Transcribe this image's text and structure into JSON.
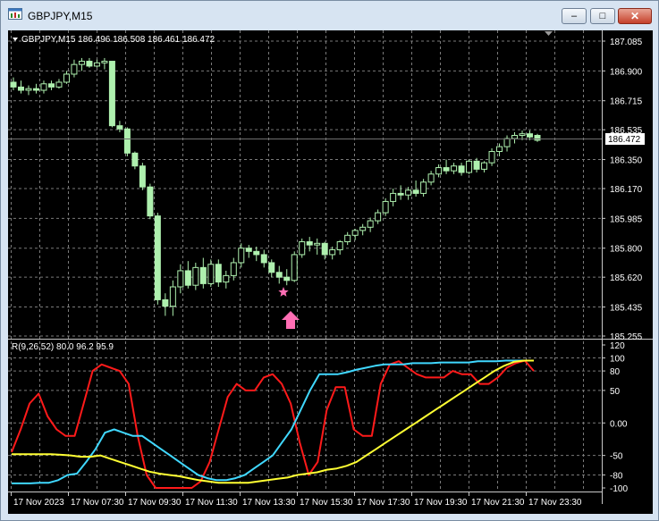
{
  "window": {
    "title": "GBPJPY,M15",
    "buttons": {
      "minimize": "–",
      "maximize": "□",
      "close": "✕"
    }
  },
  "main_chart": {
    "header": "GBPJPY,M15  186.496 186.508 186.461 186.472",
    "current_price": "186.472",
    "y_ticks": [
      "187.085",
      "186.900",
      "186.715",
      "186.535",
      "186.350",
      "186.170",
      "185.985",
      "185.800",
      "185.620",
      "185.435",
      "185.255"
    ],
    "candle_color": "#aef0ae",
    "background": "#000000",
    "marker_star_color": "#ff6eb4",
    "marker_arrow_color": "#ff6eb4"
  },
  "indicator": {
    "header": "R(9,26,52) 80.0 96.2 95.9",
    "y_ticks": [
      "120",
      "100",
      "80",
      "50",
      "0.00",
      "-50",
      "-80",
      "-100"
    ],
    "colors": {
      "fast": "#ff1a1a",
      "mid": "#40d8ff",
      "slow": "#ffff33"
    }
  },
  "x_labels": [
    "17 Nov 2023",
    "17 Nov 07:30",
    "17 Nov 09:30",
    "17 Nov 11:30",
    "17 Nov 13:30",
    "17 Nov 15:30",
    "17 Nov 17:30",
    "17 Nov 19:30",
    "17 Nov 21:30",
    "17 Nov 23:30"
  ],
  "chart_data": {
    "type": "candlestick",
    "symbol": "GBPJPY",
    "timeframe": "M15",
    "ylim": [
      185.255,
      187.085
    ],
    "candles": [
      [
        186.83,
        186.86,
        186.78,
        186.8
      ],
      [
        186.8,
        186.84,
        186.76,
        186.78
      ],
      [
        186.78,
        186.81,
        186.75,
        186.79
      ],
      [
        186.79,
        186.82,
        186.76,
        186.78
      ],
      [
        186.78,
        186.84,
        186.76,
        186.82
      ],
      [
        186.82,
        186.84,
        186.78,
        186.8
      ],
      [
        186.8,
        186.85,
        186.79,
        186.83
      ],
      [
        186.83,
        186.9,
        186.82,
        186.88
      ],
      [
        186.88,
        186.97,
        186.86,
        186.94
      ],
      [
        186.94,
        186.98,
        186.9,
        186.96
      ],
      [
        186.96,
        186.98,
        186.92,
        186.93
      ],
      [
        186.93,
        186.97,
        186.92,
        186.95
      ],
      [
        186.95,
        186.98,
        186.91,
        186.96
      ],
      [
        186.96,
        186.96,
        186.55,
        186.56
      ],
      [
        186.56,
        186.59,
        186.52,
        186.54
      ],
      [
        186.54,
        186.55,
        186.37,
        186.39
      ],
      [
        186.39,
        186.4,
        186.29,
        186.31
      ],
      [
        186.31,
        186.33,
        186.16,
        186.18
      ],
      [
        186.18,
        186.2,
        185.98,
        186.0
      ],
      [
        186.0,
        186.02,
        185.45,
        185.48
      ],
      [
        185.48,
        185.52,
        185.38,
        185.44
      ],
      [
        185.44,
        185.6,
        185.38,
        185.56
      ],
      [
        185.56,
        185.7,
        185.52,
        185.66
      ],
      [
        185.66,
        185.72,
        185.55,
        185.57
      ],
      [
        185.57,
        185.71,
        185.54,
        185.68
      ],
      [
        185.68,
        185.74,
        185.55,
        185.58
      ],
      [
        185.58,
        185.73,
        185.56,
        185.7
      ],
      [
        185.7,
        185.73,
        185.56,
        185.59
      ],
      [
        185.59,
        185.66,
        185.55,
        185.63
      ],
      [
        185.63,
        185.74,
        185.6,
        185.71
      ],
      [
        185.71,
        185.83,
        185.68,
        185.8
      ],
      [
        185.8,
        185.82,
        185.74,
        185.78
      ],
      [
        185.78,
        185.81,
        185.72,
        185.76
      ],
      [
        185.76,
        185.79,
        185.68,
        185.71
      ],
      [
        185.71,
        185.73,
        185.62,
        185.65
      ],
      [
        185.65,
        185.69,
        185.58,
        185.62
      ],
      [
        185.62,
        185.67,
        185.57,
        185.6
      ],
      [
        185.6,
        185.78,
        185.59,
        185.76
      ],
      [
        185.76,
        185.86,
        185.74,
        185.84
      ],
      [
        185.84,
        185.87,
        185.78,
        185.82
      ],
      [
        185.82,
        185.86,
        185.76,
        185.83
      ],
      [
        185.83,
        185.84,
        185.73,
        185.76
      ],
      [
        185.76,
        185.81,
        185.73,
        185.79
      ],
      [
        185.79,
        185.85,
        185.76,
        185.84
      ],
      [
        185.84,
        185.9,
        185.82,
        185.88
      ],
      [
        185.88,
        185.92,
        185.85,
        185.91
      ],
      [
        185.91,
        185.95,
        185.88,
        185.93
      ],
      [
        185.93,
        185.99,
        185.9,
        185.97
      ],
      [
        185.97,
        186.04,
        185.95,
        186.02
      ],
      [
        186.02,
        186.11,
        186.0,
        186.09
      ],
      [
        186.09,
        186.17,
        186.06,
        186.14
      ],
      [
        186.14,
        186.19,
        186.1,
        186.13
      ],
      [
        186.13,
        186.18,
        186.1,
        186.16
      ],
      [
        186.16,
        186.22,
        186.12,
        186.14
      ],
      [
        186.14,
        186.23,
        186.12,
        186.21
      ],
      [
        186.21,
        186.28,
        186.19,
        186.26
      ],
      [
        186.26,
        186.32,
        186.24,
        186.3
      ],
      [
        186.3,
        186.35,
        186.26,
        186.28
      ],
      [
        186.28,
        186.33,
        186.26,
        186.31
      ],
      [
        186.31,
        186.33,
        186.25,
        186.27
      ],
      [
        186.27,
        186.35,
        186.26,
        186.34
      ],
      [
        186.34,
        186.36,
        186.27,
        186.29
      ],
      [
        186.29,
        186.34,
        186.27,
        186.33
      ],
      [
        186.33,
        186.42,
        186.31,
        186.4
      ],
      [
        186.4,
        186.45,
        186.37,
        186.43
      ],
      [
        186.43,
        186.5,
        186.4,
        186.48
      ],
      [
        186.48,
        186.52,
        186.45,
        186.5
      ],
      [
        186.5,
        186.53,
        186.47,
        186.51
      ],
      [
        186.51,
        186.53,
        186.47,
        186.49
      ],
      [
        186.5,
        186.51,
        186.46,
        186.47
      ]
    ],
    "indicator_series": [
      {
        "values": [
          -45,
          -10,
          30,
          45,
          10,
          -10,
          -20,
          -20,
          30,
          80,
          90,
          85,
          80,
          60,
          -20,
          -80,
          -100,
          -100,
          -100,
          -100,
          -100,
          -90,
          -60,
          -10,
          40,
          60,
          50,
          50,
          70,
          75,
          60,
          30,
          -30,
          -80,
          -60,
          20,
          55,
          55,
          -10,
          -20,
          -20,
          60,
          90,
          95,
          85,
          75,
          70,
          70,
          70,
          80,
          75,
          75,
          60,
          60,
          70,
          85,
          92,
          96,
          80
        ]
      },
      {
        "values": [
          -93,
          -93,
          -93,
          -92,
          -92,
          -88,
          -80,
          -78,
          -60,
          -40,
          -15,
          -10,
          -15,
          -20,
          -20,
          -30,
          -40,
          -50,
          -60,
          -70,
          -80,
          -85,
          -88,
          -88,
          -85,
          -80,
          -70,
          -60,
          -50,
          -30,
          -10,
          20,
          50,
          75,
          75,
          75,
          78,
          82,
          85,
          88,
          90,
          90,
          90,
          92,
          92,
          92,
          93,
          93,
          93,
          93,
          95,
          95,
          95,
          96,
          96,
          96,
          96
        ]
      },
      {
        "values": [
          -48,
          -48,
          -48,
          -48,
          -48,
          -49,
          -50,
          -52,
          -52,
          -50,
          -55,
          -60,
          -65,
          -70,
          -75,
          -78,
          -80,
          -82,
          -85,
          -88,
          -90,
          -92,
          -92,
          -92,
          -92,
          -90,
          -88,
          -86,
          -84,
          -80,
          -78,
          -76,
          -72,
          -70,
          -66,
          -60,
          -50,
          -40,
          -30,
          -20,
          -10,
          0,
          10,
          20,
          30,
          40,
          50,
          60,
          70,
          80,
          88,
          94,
          96,
          96
        ]
      }
    ]
  }
}
